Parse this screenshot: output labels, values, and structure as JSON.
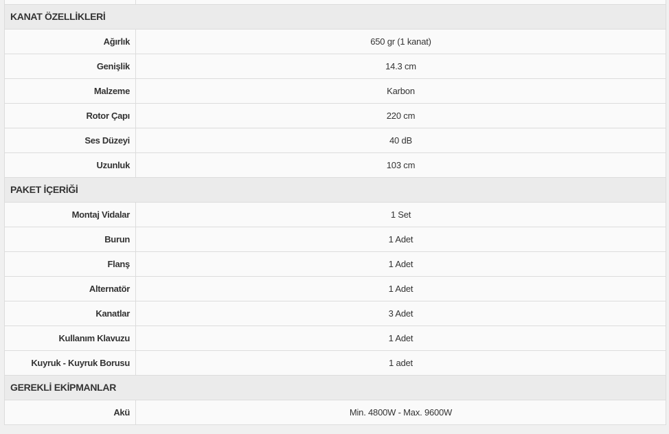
{
  "sections": [
    {
      "title": "KANAT ÖZELLİKLERİ",
      "rows": [
        {
          "label": "Ağırlık",
          "value": "650 gr (1 kanat)"
        },
        {
          "label": "Genişlik",
          "value": "14.3 cm"
        },
        {
          "label": "Malzeme",
          "value": "Karbon"
        },
        {
          "label": "Rotor Çapı",
          "value": "220 cm"
        },
        {
          "label": "Ses Düzeyi",
          "value": "40 dB"
        },
        {
          "label": "Uzunluk",
          "value": "103 cm"
        }
      ]
    },
    {
      "title": "PAKET İÇERİĞİ",
      "rows": [
        {
          "label": "Montaj Vidalar",
          "value": "1 Set"
        },
        {
          "label": "Burun",
          "value": "1 Adet"
        },
        {
          "label": "Flanş",
          "value": "1 Adet"
        },
        {
          "label": "Alternatör",
          "value": "1 Adet"
        },
        {
          "label": "Kanatlar",
          "value": "3 Adet"
        },
        {
          "label": "Kullanım Klavuzu",
          "value": "1 Adet"
        },
        {
          "label": "Kuyruk - Kuyruk Borusu",
          "value": "1 adet"
        }
      ]
    },
    {
      "title": "GEREKLİ EKİPMANLAR",
      "rows": [
        {
          "label": "Akü",
          "value": "Min. 4800W - Max. 9600W"
        }
      ]
    }
  ]
}
